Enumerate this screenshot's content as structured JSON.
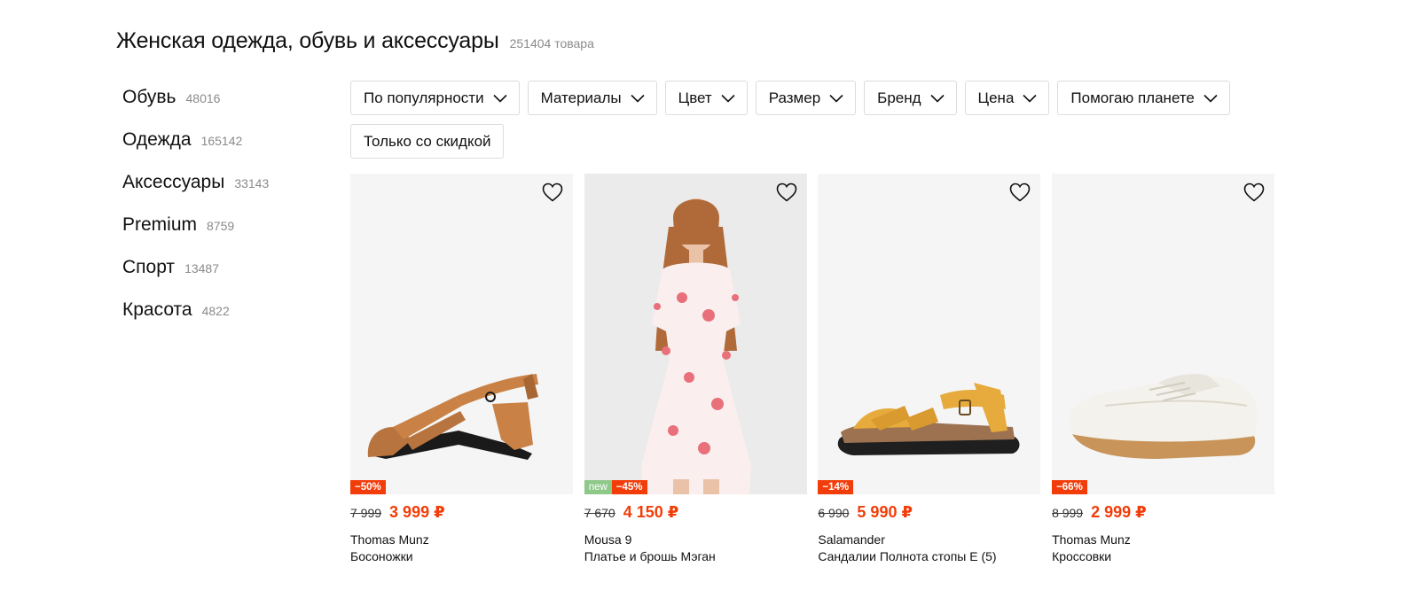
{
  "header": {
    "title": "Женская одежда, обувь и аксессуары",
    "count": "251404 товара"
  },
  "sidebar": {
    "items": [
      {
        "label": "Обувь",
        "count": "48016"
      },
      {
        "label": "Одежда",
        "count": "165142"
      },
      {
        "label": "Аксессуары",
        "count": "33143"
      },
      {
        "label": "Premium",
        "count": "8759"
      },
      {
        "label": "Спорт",
        "count": "13487"
      },
      {
        "label": "Красота",
        "count": "4822"
      }
    ]
  },
  "filters": {
    "sort": "По популярности",
    "materials": "Материалы",
    "color": "Цвет",
    "size": "Размер",
    "brand": "Бренд",
    "price": "Цена",
    "planet": "Помогаю планете",
    "discount_only": "Только со скидкой"
  },
  "products": [
    {
      "discount": "−50%",
      "old_price": "7 999",
      "price": "3 999 ₽",
      "brand": "Thomas Munz",
      "name": "Босоножки"
    },
    {
      "new_label": "new",
      "discount": "−45%",
      "old_price": "7 670",
      "price": "4 150 ₽",
      "brand": "Mousa 9",
      "name": "Платье и брошь Мэган"
    },
    {
      "discount": "−14%",
      "old_price": "6 990",
      "price": "5 990 ₽",
      "brand": "Salamander",
      "name": "Сандалии Полнота стопы E (5)"
    },
    {
      "discount": "−66%",
      "old_price": "8 999",
      "price": "2 999 ₽",
      "brand": "Thomas Munz",
      "name": "Кроссовки"
    }
  ],
  "icons": {
    "favorite": "heart-outline-icon",
    "dropdown": "chevron-down-icon"
  },
  "colors": {
    "accent_sale": "#f23d0a",
    "badge_new": "#8fc98a",
    "card_background": "#f5f5f5",
    "muted_text": "#8a8a8a"
  }
}
